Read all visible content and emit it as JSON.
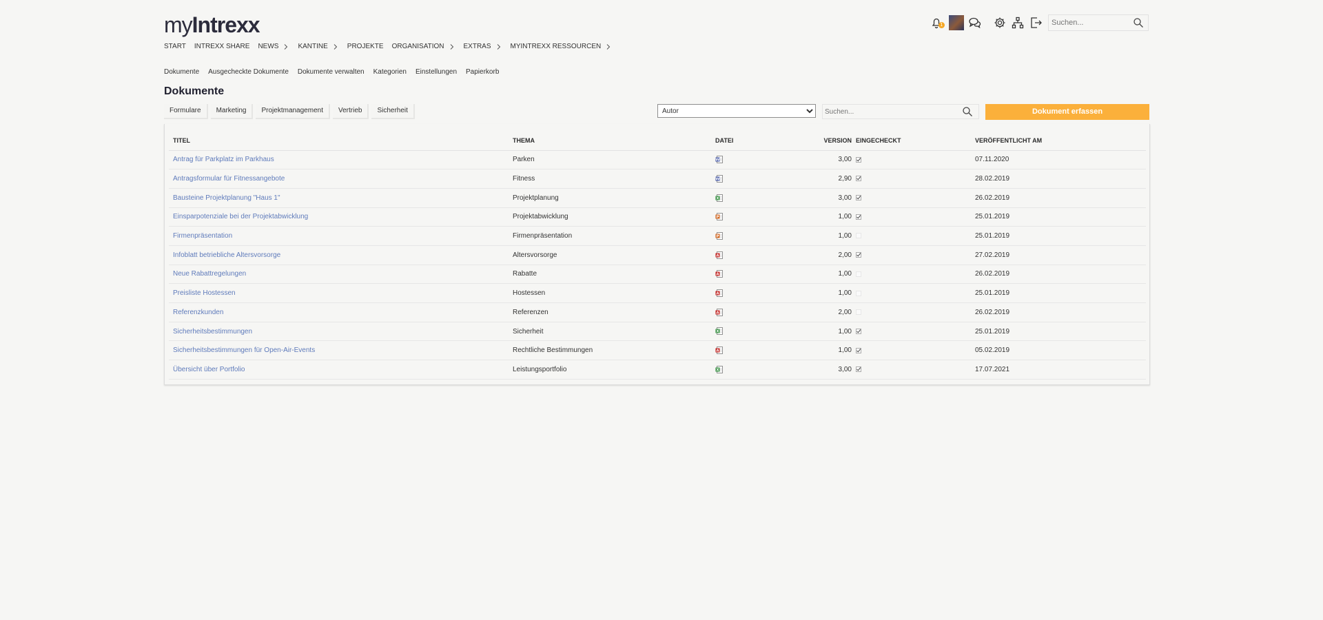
{
  "app": {
    "logo_prefix": "my",
    "logo_brand": "Intrexx"
  },
  "header": {
    "notification_count": "1",
    "search_placeholder": "Suchen..."
  },
  "main_nav": [
    {
      "label": "START",
      "chevron": false
    },
    {
      "label": "INTREXX SHARE",
      "chevron": false
    },
    {
      "label": "NEWS",
      "chevron": true
    },
    {
      "label": "KANTINE",
      "chevron": true
    },
    {
      "label": "PROJEKTE",
      "chevron": false
    },
    {
      "label": "ORGANISATION",
      "chevron": true
    },
    {
      "label": "EXTRAS",
      "chevron": true
    },
    {
      "label": "MYINTREXX RESSOURCEN",
      "chevron": true
    }
  ],
  "sub_nav": [
    "Dokumente",
    "Ausgecheckte Dokumente",
    "Dokumente verwalten",
    "Kategorien",
    "Einstellungen",
    "Papierkorb"
  ],
  "page_title": "Dokumente",
  "filter_tabs": [
    "Formulare",
    "Marketing",
    "Projektmanagement",
    "Vertrieb",
    "Sicherheit"
  ],
  "author_select": {
    "selected": "Autor"
  },
  "doc_search": {
    "placeholder": "Suchen..."
  },
  "add_button": "Dokument erfassen",
  "colors": {
    "accent": "#fbb03b",
    "link": "#5f7bbb",
    "word": "#3a4ea0",
    "excel": "#2e8b3a",
    "ppt": "#d0651f",
    "pdf": "#c0221f"
  },
  "table": {
    "columns": [
      "TITEL",
      "THEMA",
      "DATEI",
      "VERSION",
      "EINGECHECKT",
      "VERÖFFENTLICHT AM"
    ],
    "rows": [
      {
        "title": "Antrag für Parkplatz im Parkhaus",
        "topic": "Parken",
        "file": "word",
        "version": "3,00",
        "checked_in": true,
        "published": "07.11.2020"
      },
      {
        "title": "Antragsformular für Fitnessangebote",
        "topic": "Fitness",
        "file": "word",
        "version": "2,90",
        "checked_in": true,
        "published": "28.02.2019"
      },
      {
        "title": "Bausteine Projektplanung \"Haus 1\"",
        "topic": "Projektplanung",
        "file": "excel",
        "version": "3,00",
        "checked_in": true,
        "published": "26.02.2019"
      },
      {
        "title": "Einsparpotenziale bei der Projektabwicklung",
        "topic": "Projektabwicklung",
        "file": "ppt",
        "version": "1,00",
        "checked_in": true,
        "published": "25.01.2019"
      },
      {
        "title": "Firmenpräsentation",
        "topic": "Firmenpräsentation",
        "file": "ppt",
        "version": "1,00",
        "checked_in": false,
        "published": "25.01.2019"
      },
      {
        "title": "Infoblatt betriebliche Altersvorsorge",
        "topic": "Altersvorsorge",
        "file": "pdf",
        "version": "2,00",
        "checked_in": true,
        "published": "27.02.2019"
      },
      {
        "title": "Neue Rabattregelungen",
        "topic": "Rabatte",
        "file": "pdf",
        "version": "1,00",
        "checked_in": false,
        "published": "26.02.2019"
      },
      {
        "title": "Preisliste Hostessen",
        "topic": "Hostessen",
        "file": "pdf",
        "version": "1,00",
        "checked_in": false,
        "published": "25.01.2019"
      },
      {
        "title": "Referenzkunden",
        "topic": "Referenzen",
        "file": "pdf",
        "version": "2,00",
        "checked_in": false,
        "published": "26.02.2019"
      },
      {
        "title": "Sicherheitsbestimmungen",
        "topic": "Sicherheit",
        "file": "excel",
        "version": "1,00",
        "checked_in": true,
        "published": "25.01.2019"
      },
      {
        "title": "Sicherheitsbestimmungen für Open-Air-Events",
        "topic": "Rechtliche Bestimmungen",
        "file": "pdf",
        "version": "1,00",
        "checked_in": true,
        "published": "05.02.2019"
      },
      {
        "title": "Übersicht über Portfolio",
        "topic": "Leistungsportfolio",
        "file": "excel",
        "version": "3,00",
        "checked_in": true,
        "published": "17.07.2021"
      }
    ]
  }
}
